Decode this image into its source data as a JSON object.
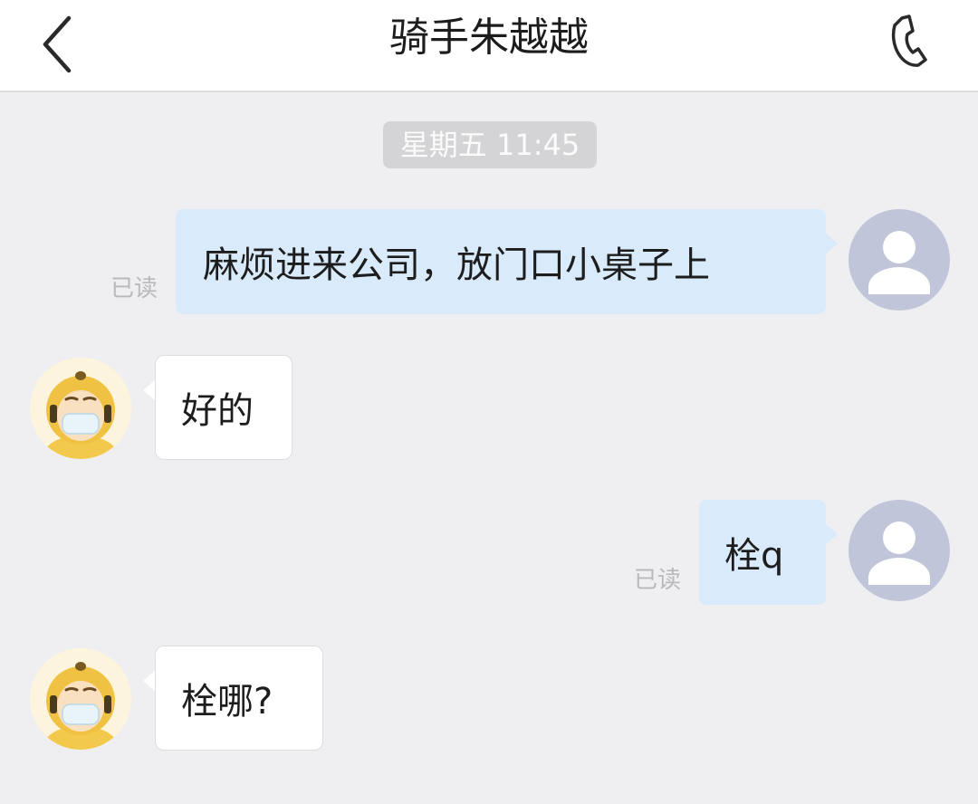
{
  "header": {
    "title": "骑手朱越越",
    "back_icon": "chevron-left-icon",
    "call_icon": "phone-icon"
  },
  "timestamp": "星期五 11:45",
  "messages": [
    {
      "side": "out",
      "text": "麻烦进来公司，放门口小桌子上",
      "status": "已读"
    },
    {
      "side": "in",
      "text": "好的"
    },
    {
      "side": "out",
      "text": "栓q",
      "status": "已读"
    },
    {
      "side": "in",
      "text": "栓哪?"
    }
  ],
  "colors": {
    "background": "#efeff1",
    "header": "#ffffff",
    "outgoing_bubble": "#d9ebfa",
    "incoming_bubble": "#ffffff",
    "time_pill": "#d4d4d6",
    "default_avatar": "#c0c5d9",
    "rider_helmet": "#f2c94c"
  }
}
